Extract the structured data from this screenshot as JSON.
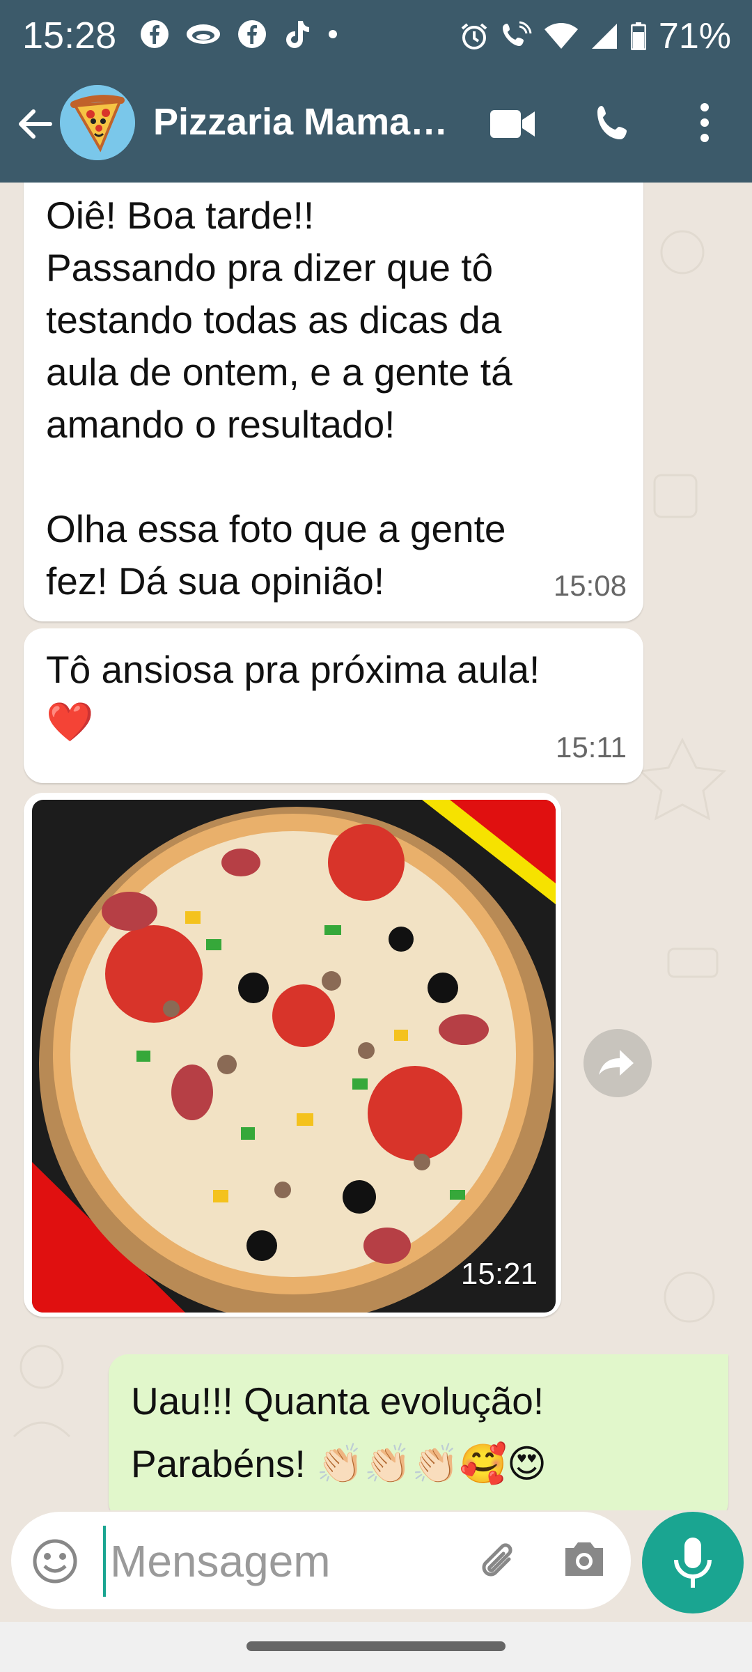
{
  "status_bar": {
    "time": "15:28",
    "battery": "71%",
    "icons": [
      "facebook-icon",
      "sight-icon",
      "facebook-icon",
      "tiktok-icon",
      "dot-icon",
      "alarm-icon",
      "wifi-call-icon",
      "wifi-icon",
      "signal-icon",
      "battery-icon"
    ]
  },
  "header": {
    "contact_name": "Pizzaria Mama…",
    "icons": [
      "back-arrow-icon",
      "video-call-icon",
      "voice-call-icon",
      "more-options-icon"
    ]
  },
  "messages": [
    {
      "type": "text",
      "direction": "incoming",
      "text": "Oiê! Boa tarde!!\nPassando pra dizer que tô\ntestando todas as dicas da\naula de ontem, e a gente tá\namando o resultado!\n\nOlha essa foto que a gente\nfez! Dá sua opinião!",
      "time": "15:08"
    },
    {
      "type": "text",
      "direction": "incoming",
      "text": "Tô ansiosa pra próxima aula!\n❤️",
      "time": "15:11"
    },
    {
      "type": "image",
      "direction": "incoming",
      "description_icon": "pizza-photo",
      "time": "15:21"
    },
    {
      "type": "text",
      "direction": "outgoing",
      "text": "Uau!!! Quanta evolução!\nParabéns! 👏🏻👏🏻👏🏻🥰😍",
      "time": ""
    }
  ],
  "composer": {
    "placeholder": "Mensagem",
    "value": ""
  },
  "colors": {
    "header_bg": "#3c5a6a",
    "chat_bg": "#ece5dd",
    "incoming_bubble": "#ffffff",
    "outgoing_bubble": "#e1f7cb",
    "accent": "#1aa591"
  }
}
